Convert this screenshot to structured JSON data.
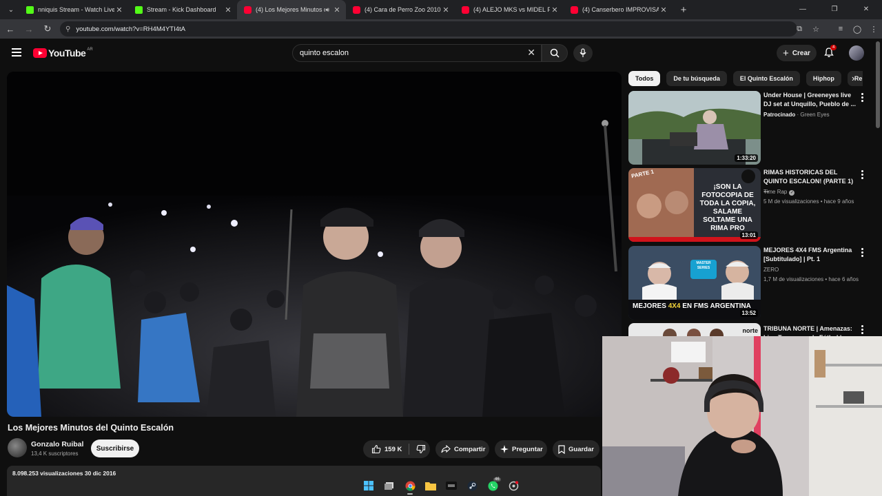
{
  "browser": {
    "tabs": [
      {
        "title": "nniquis Stream - Watch Live on",
        "icon": "kick",
        "active": false
      },
      {
        "title": "Stream - Kick Dashboard",
        "icon": "kick",
        "active": false
      },
      {
        "title": "(4) Los Mejores Minutos de",
        "icon": "youtube",
        "active": true
      },
      {
        "title": "(4) Cara de Perro Zoo 2010 - Fi",
        "icon": "youtube",
        "active": false
      },
      {
        "title": "(4) ALEJO MKS vs MIDEL FRUO",
        "icon": "youtube",
        "active": false
      },
      {
        "title": "(4) Canserbero IMPROVISANDO",
        "icon": "youtube",
        "active": false
      }
    ],
    "url": "youtube.com/watch?v=RH4M4YTI4tA"
  },
  "youtube": {
    "logo_text": "YouTube",
    "country": "AR",
    "search_value": "quinto escalon",
    "create_label": "Crear",
    "notifications_count": "4"
  },
  "video": {
    "title": "Los Mejores Minutos del Quinto Escalón",
    "channel": "Gonzalo Ruibal",
    "subscribers": "13,4 K suscriptores",
    "subscribe_label": "Suscribirse",
    "likes": "159 K",
    "share_label": "Compartir",
    "ask_label": "Preguntar",
    "save_label": "Guardar",
    "description_meta": "8.098.253 visualizaciones  30 dic 2016"
  },
  "chips": [
    "Todos",
    "De tu búsqueda",
    "El Quinto Escalón",
    "Hiphop",
    "Relac"
  ],
  "recommendations": [
    {
      "title": "Under House | Greeneyes live DJ set at Unquillo, Pueblo de ...",
      "channel_prefix": "Patrocinado",
      "channel": "Green Eyes",
      "meta": "",
      "duration": "1:33:20"
    },
    {
      "title": "RIMAS HISTORICAS DEL QUINTO ESCALON! (PARTE 1) ...",
      "channel_prefix": "",
      "channel": "Time Rap",
      "meta": "5 M de visualizaciones • hace 9 años",
      "duration": "13:01",
      "thumb_text": "¡SON LA FOTOCOPIA DE TODA LA COPIA, SALAME SOLTAME UNA RIMA PRO",
      "thumb_tag": "PARTE 1"
    },
    {
      "title": "MEJORES 4X4 FMS Argentina [Subtitulado] | Pt. 1",
      "channel_prefix": "",
      "channel": "ZERO",
      "meta": "1,7 M de visualizaciones • hace 6 años",
      "duration": "13:52",
      "thumb_text_a": "MEJORES ",
      "thumb_text_b": "4X4",
      "thumb_text_c": " EN FMS ARGENTINA",
      "thumb_badge": "MASTER SERIES"
    },
    {
      "title": "TRIBUNA NORTE | Amenazas: Liga Tucumana de Fútbol | ...",
      "channel_prefix": "",
      "channel": "",
      "meta": "",
      "duration": "",
      "thumb_tag": "norte"
    }
  ],
  "taskbar": {
    "whatsapp_badge": "46"
  },
  "colors": {
    "youtube_red": "#ff0033",
    "kick_green": "#53fc18",
    "background": "#0f0f0f"
  }
}
